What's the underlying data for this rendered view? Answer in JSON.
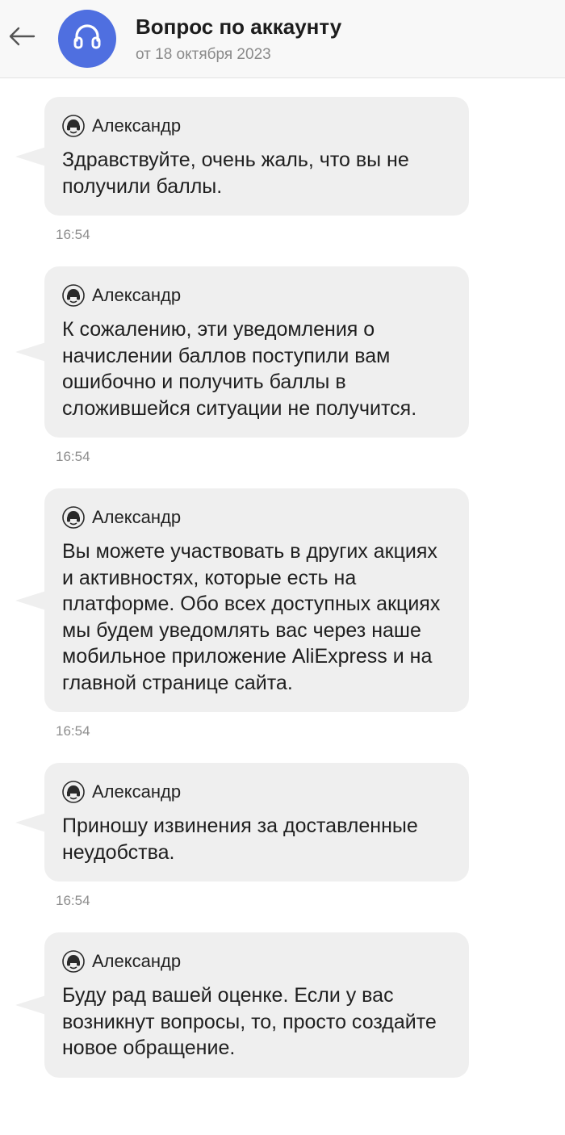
{
  "header": {
    "title": "Вопрос по аккаунту",
    "subtitle": "от 18 октября 2023",
    "back_icon": "arrow-left-icon",
    "avatar_icon": "headset-icon",
    "avatar_color": "#4f6fe0"
  },
  "messages": [
    {
      "author": "Александр",
      "text": "Здравствуйте, очень жаль, что вы не получили баллы.",
      "time": "16:54"
    },
    {
      "author": "Александр",
      "text": "К сожалению, эти уведомления о начислении баллов поступили вам ошибочно и получить баллы в сложившейся ситуации не получится.",
      "time": "16:54"
    },
    {
      "author": "Александр",
      "text": "Вы можете участвовать в других акциях и активностях, которые есть на платформе. Обо всех доступных акциях мы будем уведомлять вас через наше мобильное приложение AliExpress и на главной странице сайта.",
      "time": "16:54"
    },
    {
      "author": "Александр",
      "text": "Приношу извинения за доставленные неудобства.",
      "time": "16:54"
    },
    {
      "author": "Александр",
      "text": "Буду рад вашей оценке. Если у вас возникнут вопросы, то, просто создайте новое обращение.",
      "time": ""
    }
  ],
  "colors": {
    "bubble_bg": "#efefef",
    "header_bg": "#f8f8f8",
    "time_text": "#8d8d8d"
  }
}
